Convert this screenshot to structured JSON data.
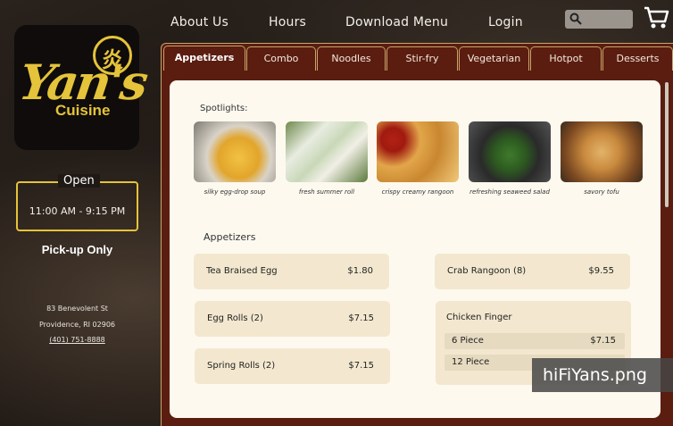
{
  "nav": {
    "links": [
      "About Us",
      "Hours",
      "Download Menu",
      "Login"
    ],
    "search_icon": "search-icon",
    "cart_icon": "cart-icon"
  },
  "logo": {
    "seal_char": "炎",
    "brand": "Yan's",
    "sub": "Cuisine"
  },
  "hours": {
    "title": "Open",
    "time": "11:00 AM - 9:15 PM",
    "pickup": "Pick-up Only"
  },
  "address": {
    "street": "83 Benevolent St",
    "city": "Providence, RI 02906",
    "phone": "(401) 751-8888"
  },
  "tabs": [
    "Appetizers",
    "Combo",
    "Noodles",
    "Stir-fry",
    "Vegetarian",
    "Hotpot",
    "Desserts"
  ],
  "active_tab": "Appetizers",
  "spotlights": {
    "title": "Spotlights:",
    "items": [
      {
        "caption": "silky egg-drop soup"
      },
      {
        "caption": "fresh summer roll"
      },
      {
        "caption": "crispy creamy rangoon"
      },
      {
        "caption": "refreshing seaweed salad"
      },
      {
        "caption": "savory tofu"
      }
    ]
  },
  "section": {
    "title": "Appetizers",
    "items": [
      {
        "name": "Tea Braised Egg",
        "price": "$1.80"
      },
      {
        "name": "Crab Rangoon (8)",
        "price": "$9.55"
      },
      {
        "name": "Egg Rolls (2)",
        "price": "$7.15"
      },
      {
        "name": "Spring Rolls (2)",
        "price": "$7.15"
      },
      {
        "name": "Chicken Finger",
        "options": [
          {
            "name": "6 Piece",
            "price": "$7.15"
          },
          {
            "name": "12 Piece",
            "price": ""
          }
        ]
      }
    ]
  },
  "overlay_filename": "hiFiYans.png",
  "colors": {
    "accent_gold": "#e5c33a",
    "panel_red": "#5a1d10",
    "card_bg": "#f3e8cf",
    "content_bg": "#fdf9ef"
  }
}
